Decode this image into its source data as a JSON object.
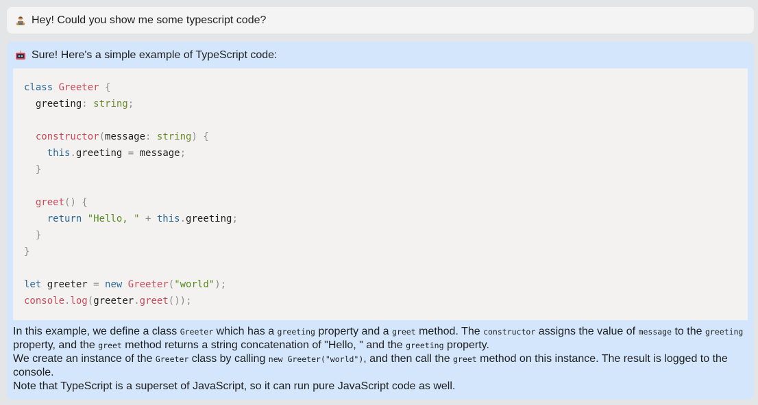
{
  "user_message": {
    "avatar_icon": "user-avatar-icon",
    "text": "Hey! Could you show me some typescript code?"
  },
  "assistant_message": {
    "avatar_icon": "robot-avatar-icon",
    "intro": "Sure! Here's a simple example of TypeScript code:",
    "code_lines": [
      [
        {
          "t": "kw",
          "v": "class "
        },
        {
          "t": "cls",
          "v": "Greeter"
        },
        {
          "t": "punc",
          "v": " {"
        }
      ],
      [
        {
          "t": "id",
          "v": "  greeting"
        },
        {
          "t": "punc",
          "v": ": "
        },
        {
          "t": "type",
          "v": "string"
        },
        {
          "t": "punc",
          "v": ";"
        }
      ],
      [],
      [
        {
          "t": "fn",
          "v": "  constructor"
        },
        {
          "t": "punc",
          "v": "("
        },
        {
          "t": "id",
          "v": "message"
        },
        {
          "t": "punc",
          "v": ": "
        },
        {
          "t": "type",
          "v": "string"
        },
        {
          "t": "punc",
          "v": ") {"
        }
      ],
      [
        {
          "t": "kw",
          "v": "    this"
        },
        {
          "t": "punc",
          "v": "."
        },
        {
          "t": "id",
          "v": "greeting"
        },
        {
          "t": "punc",
          "v": " = "
        },
        {
          "t": "id",
          "v": "message"
        },
        {
          "t": "punc",
          "v": ";"
        }
      ],
      [
        {
          "t": "punc",
          "v": "  }"
        }
      ],
      [],
      [
        {
          "t": "fn",
          "v": "  greet"
        },
        {
          "t": "punc",
          "v": "() {"
        }
      ],
      [
        {
          "t": "kw",
          "v": "    return "
        },
        {
          "t": "str",
          "v": "\"Hello, \""
        },
        {
          "t": "punc",
          "v": " + "
        },
        {
          "t": "kw",
          "v": "this"
        },
        {
          "t": "punc",
          "v": "."
        },
        {
          "t": "id",
          "v": "greeting"
        },
        {
          "t": "punc",
          "v": ";"
        }
      ],
      [
        {
          "t": "punc",
          "v": "  }"
        }
      ],
      [
        {
          "t": "punc",
          "v": "}"
        }
      ],
      [],
      [
        {
          "t": "kw",
          "v": "let "
        },
        {
          "t": "id",
          "v": "greeter"
        },
        {
          "t": "punc",
          "v": " = "
        },
        {
          "t": "kw",
          "v": "new "
        },
        {
          "t": "cls",
          "v": "Greeter"
        },
        {
          "t": "punc",
          "v": "("
        },
        {
          "t": "str",
          "v": "\"world\""
        },
        {
          "t": "punc",
          "v": ");"
        }
      ],
      [
        {
          "t": "fn",
          "v": "console"
        },
        {
          "t": "punc",
          "v": "."
        },
        {
          "t": "fn",
          "v": "log"
        },
        {
          "t": "punc",
          "v": "("
        },
        {
          "t": "id",
          "v": "greeter"
        },
        {
          "t": "punc",
          "v": "."
        },
        {
          "t": "fn",
          "v": "greet"
        },
        {
          "t": "punc",
          "v": "());"
        }
      ]
    ],
    "explanation": [
      [
        {
          "t": "text",
          "v": "In this example, we define a class "
        },
        {
          "t": "code",
          "v": "Greeter"
        },
        {
          "t": "text",
          "v": " which has a "
        },
        {
          "t": "code",
          "v": "greeting"
        },
        {
          "t": "text",
          "v": " property and a "
        },
        {
          "t": "code",
          "v": "greet"
        },
        {
          "t": "text",
          "v": " method. The "
        },
        {
          "t": "code",
          "v": "constructor"
        },
        {
          "t": "text",
          "v": " assigns the value of "
        },
        {
          "t": "code",
          "v": "message"
        },
        {
          "t": "text",
          "v": " to the "
        },
        {
          "t": "code",
          "v": "greeting"
        },
        {
          "t": "text",
          "v": " property, and the "
        },
        {
          "t": "code",
          "v": "greet"
        },
        {
          "t": "text",
          "v": " method returns a string concatenation of \"Hello, \" and the "
        },
        {
          "t": "code",
          "v": "greeting"
        },
        {
          "t": "text",
          "v": " property."
        }
      ],
      [
        {
          "t": "text",
          "v": "We create an instance of the "
        },
        {
          "t": "code",
          "v": "Greeter"
        },
        {
          "t": "text",
          "v": " class by calling "
        },
        {
          "t": "code",
          "v": "new Greeter(\"world\")"
        },
        {
          "t": "text",
          "v": ", and then call the "
        },
        {
          "t": "code",
          "v": "greet"
        },
        {
          "t": "text",
          "v": " method on this instance. The result is logged to the console."
        }
      ],
      [
        {
          "t": "text",
          "v": "Note that TypeScript is a superset of JavaScript, so it can run pure JavaScript code as well."
        }
      ]
    ]
  },
  "colors": {
    "page_bg": "#e4e5e7",
    "user_bubble": "#f4f4f5",
    "assistant_bubble": "#d3e6fb",
    "code_bg": "#f3f2f0",
    "keyword": "#2a6896",
    "class_fn": "#c84a5a",
    "type_string": "#6a8d2a",
    "punctuation": "#8b8b8b"
  }
}
